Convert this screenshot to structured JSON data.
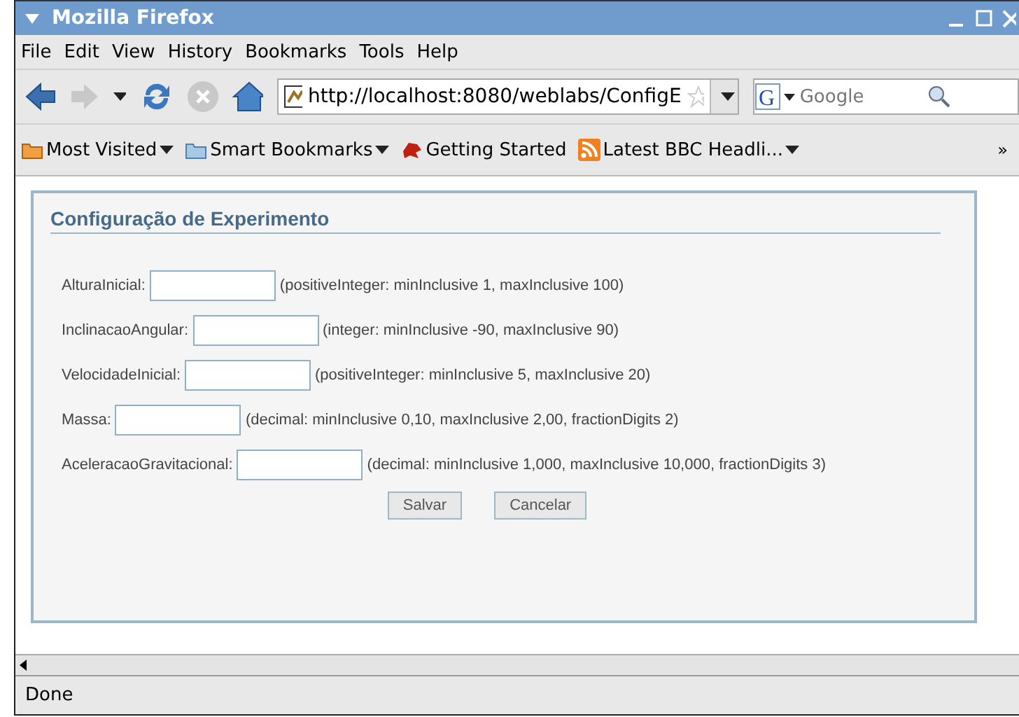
{
  "window": {
    "title": "Mozilla Firefox"
  },
  "menu": [
    "File",
    "Edit",
    "View",
    "History",
    "Bookmarks",
    "Tools",
    "Help"
  ],
  "address": {
    "value": "http://localhost:8080/weblabs/ConfigE"
  },
  "search": {
    "placeholder": "Google",
    "engine_letter": "G"
  },
  "bookmarks": [
    {
      "label": "Most Visited",
      "kind": "folder-orange",
      "dropdown": true
    },
    {
      "label": "Smart Bookmarks",
      "kind": "folder",
      "dropdown": true
    },
    {
      "label": "Getting Started",
      "kind": "dragon",
      "dropdown": false
    },
    {
      "label": "Latest BBC Headli...",
      "kind": "rss",
      "dropdown": true
    }
  ],
  "bookmarks_overflow": "»",
  "form": {
    "title": "Configuração de Experimento",
    "fields": [
      {
        "label": "AlturaInicial:",
        "hint": "(positiveInteger: minInclusive 1, maxInclusive 100)"
      },
      {
        "label": "InclinacaoAngular:",
        "hint": "(integer: minInclusive -90, maxInclusive 90)"
      },
      {
        "label": "VelocidadeInicial:",
        "hint": "(positiveInteger: minInclusive 5, maxInclusive 20)"
      },
      {
        "label": "Massa:",
        "hint": "(decimal: minInclusive 0,10, maxInclusive 2,00, fractionDigits 2)"
      },
      {
        "label": "AceleracaoGravitacional:",
        "hint": "(decimal: minInclusive 1,000, maxInclusive 10,000, fractionDigits 3)"
      }
    ],
    "buttons": [
      "Salvar",
      "Cancelar"
    ]
  },
  "status_bar": "Done"
}
